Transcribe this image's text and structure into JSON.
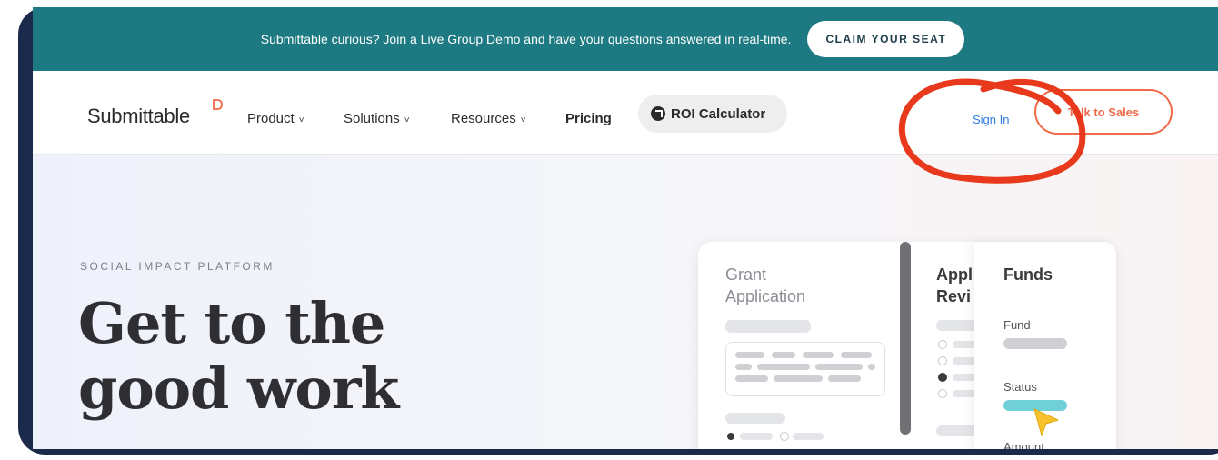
{
  "banner": {
    "text": "Submittable curious? Join a Live Group Demo and have your questions answered in real-time.",
    "cta": "CLAIM YOUR SEAT"
  },
  "nav": {
    "logo": "Submittable",
    "items": [
      "Product",
      "Solutions",
      "Resources",
      "Pricing"
    ],
    "roi": "ROI Calculator",
    "sign_in": "Sign In",
    "talk_to_sales": "Talk to Sales"
  },
  "hero": {
    "eyebrow": "SOCIAL IMPACT PLATFORM",
    "headline_line1": "Get to the",
    "headline_line2": "good work"
  },
  "mockup": {
    "grant_title_1": "Grant",
    "grant_title_2": "Application",
    "review_title_1": "Appl",
    "review_title_2": "Revi",
    "funds_title": "Funds",
    "fund_label": "Fund",
    "status_label": "Status",
    "amount_label": "Amount"
  },
  "colors": {
    "banner": "#1e7a82",
    "accent": "#f06a4a",
    "link": "#2f7de1",
    "annotation": "#e8391c"
  }
}
